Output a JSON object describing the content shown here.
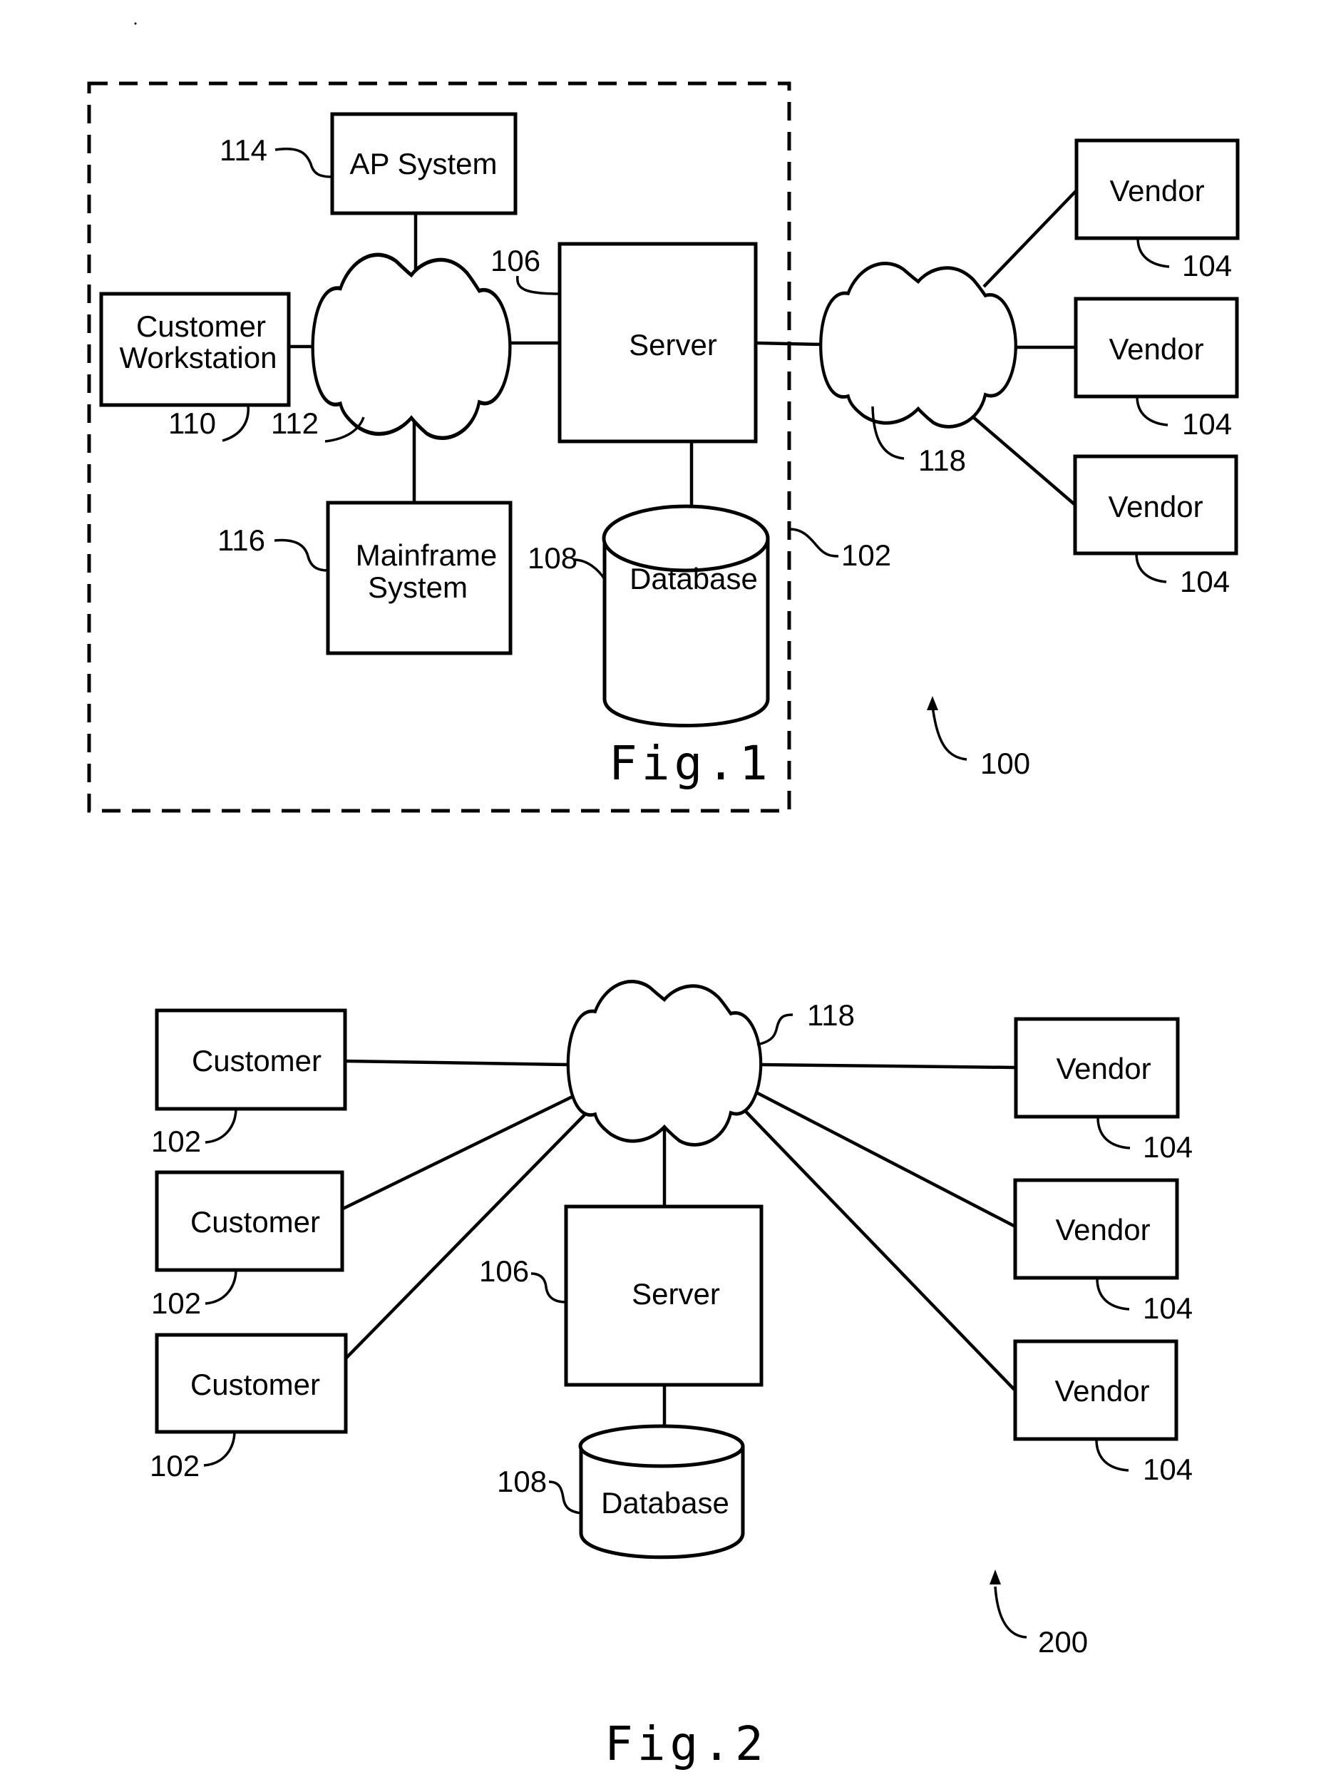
{
  "figure1": {
    "caption": "Fig.1",
    "system_ref": "100",
    "enterprise_ref": "102",
    "nodes": {
      "ap_system": {
        "label": "AP System",
        "ref": "114"
      },
      "customer_workstation": {
        "label_line1": "Customer",
        "label_line2": "Workstation",
        "ref": "110"
      },
      "internal_network": {
        "ref": "112"
      },
      "mainframe": {
        "label_line1": "Mainframe",
        "label_line2": "System",
        "ref": "116"
      },
      "server": {
        "label": "Server",
        "ref": "106"
      },
      "database": {
        "label": "Database",
        "ref": "108"
      },
      "external_network": {
        "ref": "118"
      },
      "vendors": [
        {
          "label": "Vendor",
          "ref": "104"
        },
        {
          "label": "Vendor",
          "ref": "104"
        },
        {
          "label": "Vendor",
          "ref": "104"
        }
      ]
    }
  },
  "figure2": {
    "caption": "Fig.2",
    "system_ref": "200",
    "nodes": {
      "customers": [
        {
          "label": "Customer",
          "ref": "102"
        },
        {
          "label": "Customer",
          "ref": "102"
        },
        {
          "label": "Customer",
          "ref": "102"
        }
      ],
      "network": {
        "ref": "118"
      },
      "server": {
        "label": "Server",
        "ref": "106"
      },
      "database": {
        "label": "Database",
        "ref": "108"
      },
      "vendors": [
        {
          "label": "Vendor",
          "ref": "104"
        },
        {
          "label": "Vendor",
          "ref": "104"
        },
        {
          "label": "Vendor",
          "ref": "104"
        }
      ]
    }
  }
}
